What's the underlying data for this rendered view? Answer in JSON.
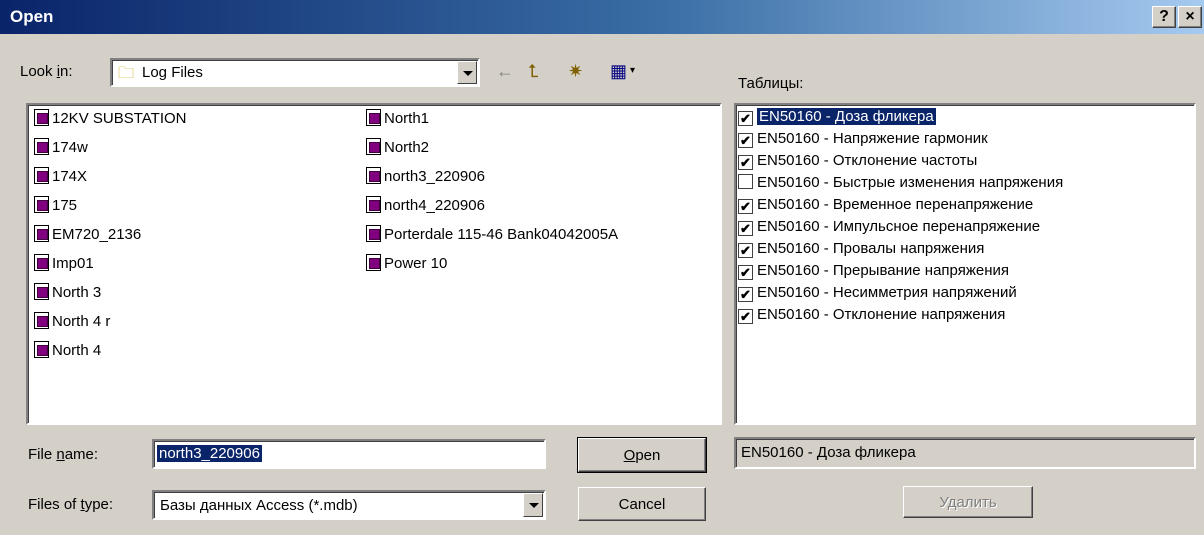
{
  "window": {
    "title": "Open",
    "help_label": "?",
    "close_label": "×"
  },
  "look_in": {
    "label_pre": "Look ",
    "label_key": "i",
    "label_post": "n:",
    "value": "Log Files"
  },
  "toolbar": {
    "back_icon": "←",
    "up_icon": "⮤",
    "new_folder_icon": "✷",
    "view_icon": "▦"
  },
  "files": {
    "col1": [
      "12KV SUBSTATION",
      "174w",
      "174X",
      "175",
      "EM720_2136",
      "Imp01",
      "North 3",
      "North 4 r",
      "North 4"
    ],
    "col2": [
      "North1",
      "North2",
      "north3_220906",
      "north4_220906",
      "Porterdale 115-46 Bank04042005A",
      "Power 10"
    ]
  },
  "filename": {
    "label_pre": "File ",
    "label_key": "n",
    "label_post": "ame:",
    "value": "north3_220906"
  },
  "filetype": {
    "label_pre": "Files of ",
    "label_key": "t",
    "label_post": "ype:",
    "value": "Базы данных Access (*.mdb)"
  },
  "buttons": {
    "open_key": "O",
    "open_rest": "pen",
    "cancel": "Cancel",
    "delete": "Удалить"
  },
  "tables": {
    "label": "Таблицы:",
    "items": [
      {
        "label": "EN50160 - Доза фликера",
        "checked": true,
        "selected": true
      },
      {
        "label": "EN50160 - Напряжение гармоник",
        "checked": true
      },
      {
        "label": "EN50160 - Отклонение частоты",
        "checked": true
      },
      {
        "label": "EN50160 - Быстрые изменения напряжения",
        "checked": false
      },
      {
        "label": "EN50160 - Временное перенапряжение",
        "checked": true
      },
      {
        "label": "EN50160 - Импульсное перенапряжение",
        "checked": true
      },
      {
        "label": "EN50160 - Провалы напряжения",
        "checked": true
      },
      {
        "label": "EN50160 - Прерывание напряжения",
        "checked": true
      },
      {
        "label": "EN50160 - Несимметрия напряжений",
        "checked": true
      },
      {
        "label": "EN50160 - Отклонение напряжения",
        "checked": true
      }
    ],
    "selected_value": "EN50160 - Доза фликера"
  }
}
